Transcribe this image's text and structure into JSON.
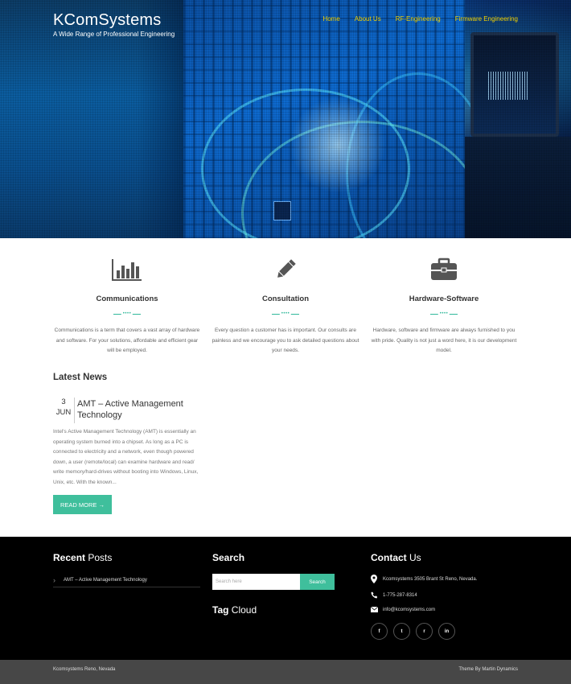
{
  "site": {
    "title": "KComSystems",
    "tagline": "A Wide Range of Professional Engineering"
  },
  "nav": {
    "items": [
      {
        "label": "Home"
      },
      {
        "label": "About Us"
      },
      {
        "label": "RF-Engineering"
      },
      {
        "label": "Firmware Engineering"
      }
    ]
  },
  "features": [
    {
      "icon": "bar-chart-icon",
      "title": "Communications",
      "text": "Communications is a term that covers a vast array of hardware and software. For your solutions, affordable and efficient gear will be employed."
    },
    {
      "icon": "pencil-icon",
      "title": "Consultation",
      "text": "Every question a customer has is important. Our consults are painless and we encourage you to ask detailed questions about your needs."
    },
    {
      "icon": "briefcase-icon",
      "title": "Hardware-Software",
      "text": "Hardware, software and firmware are always furnished to you with pride. Quality is not just a word here, it is our development model."
    }
  ],
  "news": {
    "section_title": "Latest News",
    "day": "3",
    "month": "JUN",
    "headline": "AMT – Active Management Technology",
    "excerpt": "Intel's Active Management Technology (AMT) is essentially an operating system burned into a chipset. As long as a PC is connected to electricity and a network, even though powered down, a user (remote/local) can examine hardware and read/ write memory/hard-drives without booting into Windows, Linux, Unix, etc. With the known...",
    "read_more": "READ MORE →"
  },
  "footer": {
    "recent": {
      "title_bold": "Recent",
      "title_rest": " Posts",
      "items": [
        "AMT – Active Management Technology"
      ]
    },
    "search": {
      "title": "Search",
      "placeholder": "Search here",
      "button": "Search"
    },
    "tags": {
      "title_bold": "Tag",
      "title_rest": " Cloud"
    },
    "contact": {
      "title_bold": "Contact",
      "title_rest": " Us",
      "address": "Kcomsystems 3505 Brant St Reno, Nevada.",
      "phone": "1-775-287-8314",
      "email": "info@kcomsystems.com"
    },
    "socials": [
      {
        "icon": "facebook-icon",
        "glyph": "f"
      },
      {
        "icon": "twitter-icon",
        "glyph": "t"
      },
      {
        "icon": "rss-icon",
        "glyph": "r"
      },
      {
        "icon": "linkedin-icon",
        "glyph": "in"
      }
    ]
  },
  "bottom": {
    "left": "Kcomsystems Reno, Nevada",
    "right": "Theme By Martin Dynamics"
  },
  "colors": {
    "accent": "#3fbf9c",
    "nav": "#f2d200",
    "footer_bg": "#000000",
    "bottom_bar": "#474747"
  }
}
